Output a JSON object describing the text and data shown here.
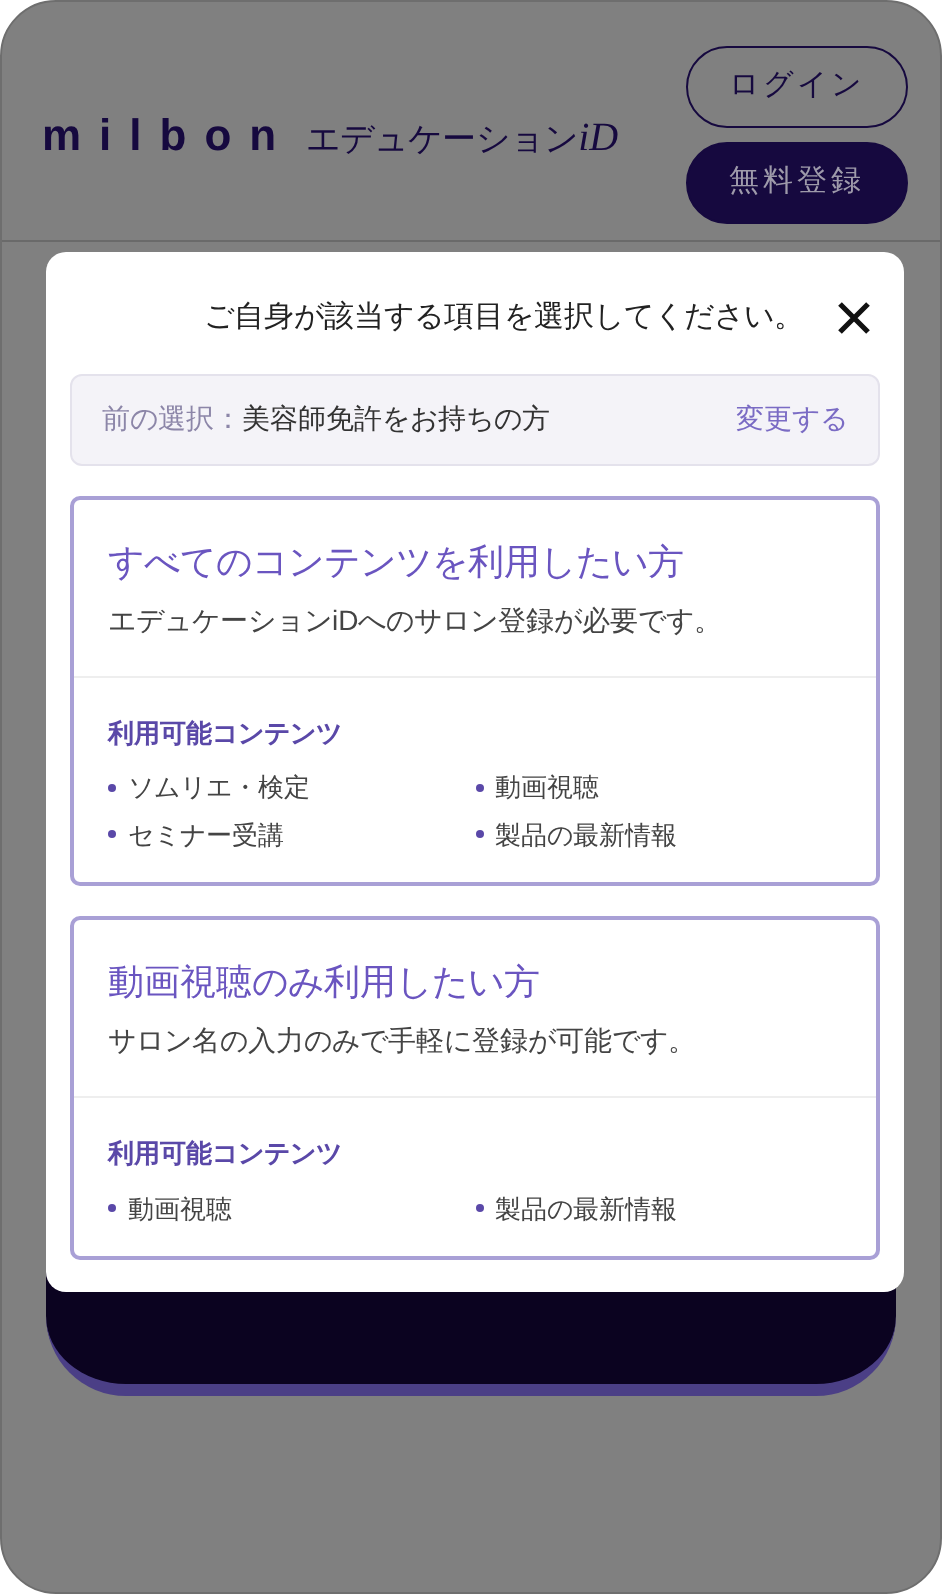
{
  "header": {
    "brand": "milbon",
    "service": "エデュケーション",
    "service_suffix": "iD",
    "buttons": [
      {
        "kind": "outline",
        "label": "ログイン"
      },
      {
        "kind": "filled",
        "label": "無料登録"
      }
    ]
  },
  "modal": {
    "title": "ご自身が該当する項目を選択してください。",
    "previous": {
      "label": "前の選択：",
      "value": "美容師免許をお持ちの方",
      "link": "変更する"
    },
    "options": [
      {
        "title": "すべてのコンテンツを利用したい方",
        "description": "エデュケーションiDへのサロン登録が必要です。",
        "contents_heading": "利用可能コンテンツ",
        "contents": [
          "ソムリエ・検定",
          "動画視聴",
          "セミナー受講",
          "製品の最新情報"
        ]
      },
      {
        "title": "動画視聴のみ利用したい方",
        "description": "サロン名の入力のみで手軽に登録が可能です。",
        "contents_heading": "利用可能コンテンツ",
        "contents": [
          "動画視聴",
          "製品の最新情報"
        ]
      }
    ]
  }
}
